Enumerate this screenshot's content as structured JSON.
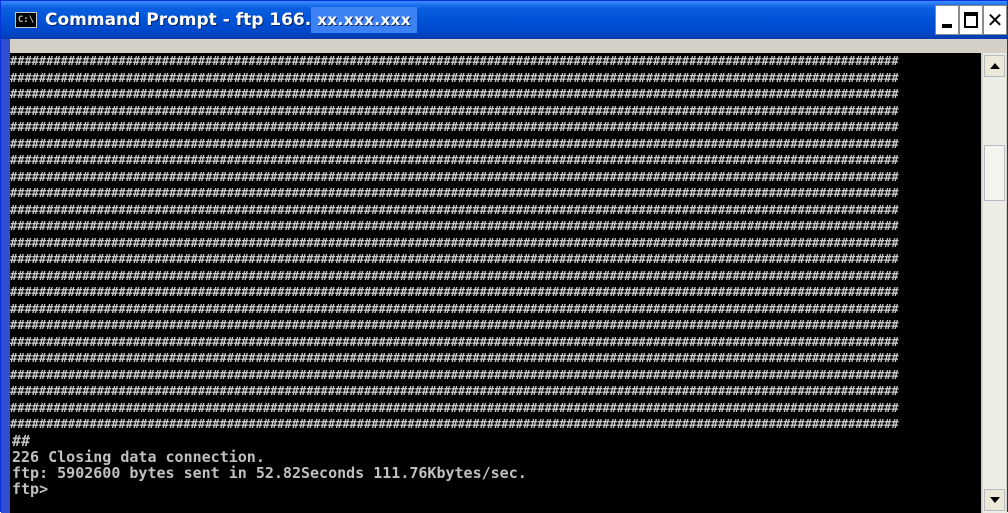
{
  "window": {
    "title_prefix": "Command Prompt - ftp 166.",
    "title_host": "xx.xxx.xxx",
    "icon_label": "C:\\"
  },
  "colors": {
    "titlebar": "#0052d6",
    "console_bg": "#000000",
    "console_fg": "#c0c0c0"
  },
  "icons": {
    "app": "command-prompt-icon",
    "minimize": "minimize-icon",
    "maximize": "maximize-icon",
    "close": "close-icon",
    "scroll_up": "arrow-up-icon",
    "scroll_down": "arrow-down-icon"
  },
  "console": {
    "hash_row": "###########################################################################################################################",
    "hash_row_count": 23,
    "lines": [
      "##",
      "226 Closing data connection.",
      "ftp: 5902600 bytes sent in 52.82Seconds 111.76Kbytes/sec.",
      "ftp>"
    ]
  }
}
